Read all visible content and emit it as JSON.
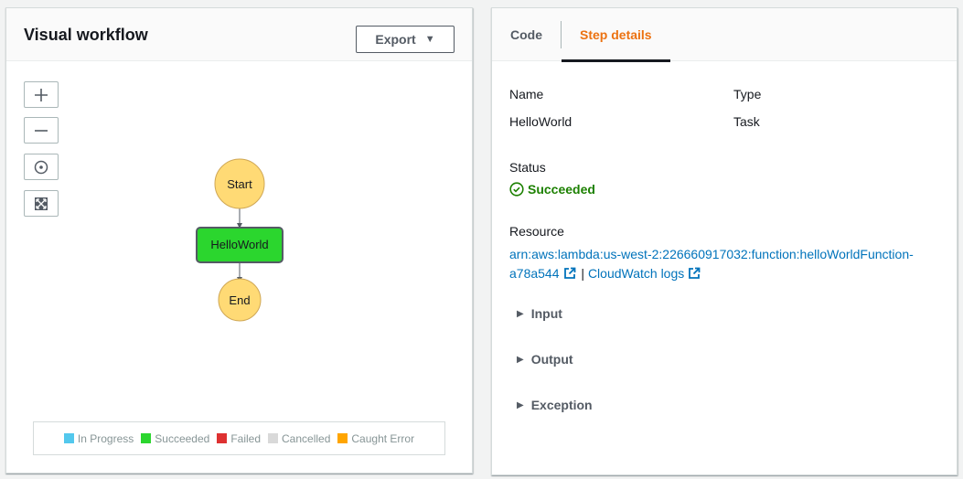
{
  "workflow": {
    "title": "Visual workflow",
    "export_label": "Export",
    "zoom_controls": [
      {
        "name": "zoom-in-button",
        "icon": "plus-icon"
      },
      {
        "name": "zoom-out-button",
        "icon": "minus-icon"
      },
      {
        "name": "center-button",
        "icon": "target-icon"
      },
      {
        "name": "fit-button",
        "icon": "expand-icon"
      }
    ],
    "nodes": [
      {
        "id": "start",
        "label": "Start",
        "shape": "circle",
        "color": "#ffda75"
      },
      {
        "id": "hello",
        "label": "HelloWorld",
        "shape": "rect",
        "color": "#2bd62e"
      },
      {
        "id": "end",
        "label": "End",
        "shape": "circle",
        "color": "#ffda75"
      }
    ],
    "legend": [
      {
        "label": "In Progress",
        "color": "#53c8ed"
      },
      {
        "label": "Succeeded",
        "color": "#2bd62e"
      },
      {
        "label": "Failed",
        "color": "#de3131"
      },
      {
        "label": "Cancelled",
        "color": "#d9d9d9"
      },
      {
        "label": "Caught Error",
        "color": "#ffa500"
      }
    ]
  },
  "details": {
    "tabs": [
      {
        "label": "Code",
        "active": false
      },
      {
        "label": "Step details",
        "active": true
      }
    ],
    "name_label": "Name",
    "name_value": "HelloWorld",
    "type_label": "Type",
    "type_value": "Task",
    "status_label": "Status",
    "status_value": "Succeeded",
    "resource_label": "Resource",
    "resource_arn": "arn:aws:lambda:us-west-2:226660917032:function:helloWorldFunction-a78a544",
    "separator": "|",
    "cloudwatch_label": "CloudWatch logs",
    "sections": [
      "Input",
      "Output",
      "Exception"
    ]
  },
  "colors": {
    "accent": "#ec7211",
    "link": "#0073bb",
    "success": "#1d8102"
  }
}
